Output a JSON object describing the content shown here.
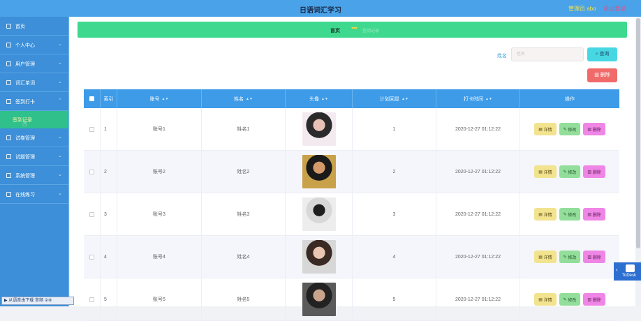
{
  "header": {
    "title": "日语词汇学习",
    "admin": "管理员 abo",
    "logout": "退出登录"
  },
  "sidebar": {
    "items": [
      {
        "label": "首页",
        "icon": "home-icon",
        "chevron": ""
      },
      {
        "label": "个人中心",
        "icon": "user-icon",
        "chevron": "⌄"
      },
      {
        "label": "用户管理",
        "icon": "users-icon",
        "chevron": "⌄"
      },
      {
        "label": "词汇单词",
        "icon": "book-icon",
        "chevron": "⌄"
      },
      {
        "label": "签到打卡",
        "icon": "checkin-icon",
        "chevron": "⌃"
      }
    ],
    "subitem": "签到记录",
    "items2": [
      {
        "label": "试卷管理",
        "icon": "paper-icon",
        "chevron": "⌄"
      },
      {
        "label": "试题管理",
        "icon": "question-icon",
        "chevron": "⌄"
      },
      {
        "label": "系统管理",
        "icon": "settings-icon",
        "chevron": "⌄"
      },
      {
        "label": "在线练习",
        "icon": "practice-icon",
        "chevron": "⌄"
      }
    ]
  },
  "breadcrumb": {
    "home": "首页",
    "hearts": "♥♥♥",
    "current": "签到记录"
  },
  "search": {
    "label": "姓名",
    "placeholder": "姓名",
    "query_button": "查询",
    "delete_button": "删除"
  },
  "table": {
    "headers": [
      "",
      "索引",
      "账号",
      "姓名",
      "头像",
      "计划回显",
      "打卡时间",
      "操作"
    ],
    "rows": [
      {
        "index": "1",
        "account": "账号1",
        "name": "姓名1",
        "plan": "1",
        "time": "2020-12-27 01:12:22"
      },
      {
        "index": "2",
        "account": "账号2",
        "name": "姓名2",
        "plan": "2",
        "time": "2020-12-27 01:12:22"
      },
      {
        "index": "3",
        "account": "账号3",
        "name": "姓名3",
        "plan": "3",
        "time": "2020-12-27 01:12:22"
      },
      {
        "index": "4",
        "account": "账号4",
        "name": "姓名4",
        "plan": "4",
        "time": "2020-12-27 01:12:22"
      },
      {
        "index": "5",
        "account": "账号5",
        "name": "姓名5",
        "plan": "5",
        "time": "2020-12-27 01:12:22"
      }
    ],
    "actions": {
      "detail": "详情",
      "edit": "修改",
      "delete": "删除"
    }
  },
  "overlay": {
    "todesk": "ToDesk",
    "taskbar": "▶ 从语音由下载 音频 ②⑧"
  },
  "colors": {
    "topbar": "#4aa3e8",
    "sidebar": "#3c8fd8",
    "breadcrumb": "#3ed98e",
    "table_header": "#3d9be8"
  }
}
